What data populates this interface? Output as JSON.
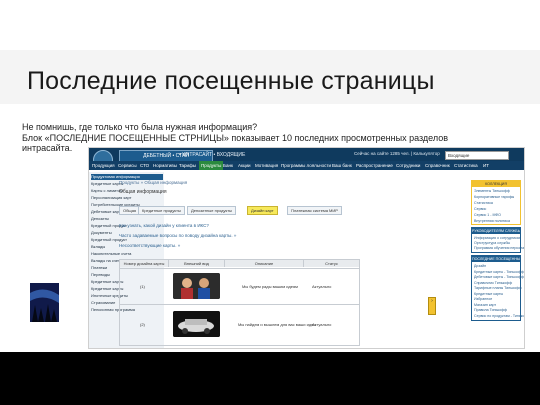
{
  "slide": {
    "title": "Последние посещенные страницы",
    "intro_line1": "Не помнишь, где только что была нужная информация?",
    "intro_line2": "Блок «ПОСЛЕДНИЕ ПОСЕЩЕННЫЕ СТРНИЦЫ» показывает 10 последних просмотренных разделов",
    "intro_line3": "интрасайта."
  },
  "header": {
    "brand": "ДЕБЕТНЫЙ • СТАЙ",
    "brand_sub": "• ИНТРАСАЙТ • ВХОДЯЩИЕ",
    "info": "Сейчас на сайте 1285 чел. | Калькулятор",
    "select_value": "Входящие"
  },
  "menu": [
    "Продукция",
    "Сервисы",
    "СТО",
    "Нормативы",
    "Тарифы",
    "Продукты",
    "Банк",
    "Акции",
    "Мотивация",
    "Программы лояльности",
    "Ваш банк",
    "Распространение",
    "Сотрудники",
    "Справочник",
    "Статистика",
    "ИТ"
  ],
  "left_sidebar": {
    "items": [
      "Продуктовая информация",
      "Кредитные карты",
      "Карты с лимитом",
      "Персонализация карт",
      "Потребительские кредиты",
      "Дебетовые карты",
      "Депозиты",
      "Кредитный продукт",
      "Документы",
      "Кредитный продукт",
      "Вклады",
      "Накопительные счета",
      "Вклады на счета",
      "Платежи",
      "Переводы",
      "Кредитные карты",
      "Кредитные карты",
      "Ипотечные кредиты",
      "Страхование",
      "Пенсионная программа"
    ]
  },
  "main": {
    "breadcrumb": "Продукты » Общая информация",
    "page_title": "Общая информация",
    "tabs": [
      "Общая",
      "Кредитные продукты",
      "Депозитные продукты",
      "Дизайн карт",
      "Платежная система МИР"
    ],
    "questions": [
      "Как узнать, какой дизайн у клиента в ИКС?",
      "Часто задаваемые вопросы по поводу дизайна карты. »",
      "Несоответствующие карты. »"
    ],
    "table": {
      "headers": [
        "Номер дизайна карты",
        "Внешний вид",
        "Описание",
        "Статус"
      ],
      "rows": [
        {
          "num": "(1)",
          "desc": "Мы будем рады вашим идеям",
          "status": "Актуально"
        },
        {
          "num": "(2)",
          "desc": "Мы найдем и вышлем для вас ваши идеи",
          "status": "Актуально"
        }
      ]
    }
  },
  "right_sidebar": {
    "box1_title": "КОЛЛЕКЦИЯ",
    "box1_links": [
      "Элементы Тинькофф",
      "Корпоративные тарифы",
      "Статистика",
      "Сервис",
      "Сервис 1 - МФО",
      "Внутренняя политика"
    ],
    "box2_title": "РУКОВОДИТЕЛЯМ СЛУЖБЫ",
    "box2_links": [
      "Информация о сотрудниках",
      "Оргструктура службы",
      "Программа обучения персонала"
    ],
    "box3_title": "ПОСЛЕДНИЕ ПОСЕЩЕННЫЕ СТРНИЦЫ",
    "box3_links": [
      "Дизайн",
      "Кредитные карты - Тинькофф Платинум",
      "Дебетовые карты - Тинькофф Black",
      "Справочник Тинькофф",
      "Тарифные планы Тинькофф",
      "Кредитные карты",
      "Избранное",
      "Магазин карт",
      "Правила Тинькофф",
      "Сервис по продуктам - Тинькофф"
    ]
  },
  "colors": {
    "header_bg": "#0f3a5e",
    "accent_blue": "#1d5c8e",
    "accent_gold": "#f2c230",
    "active_menu": "#2b8a3e"
  }
}
